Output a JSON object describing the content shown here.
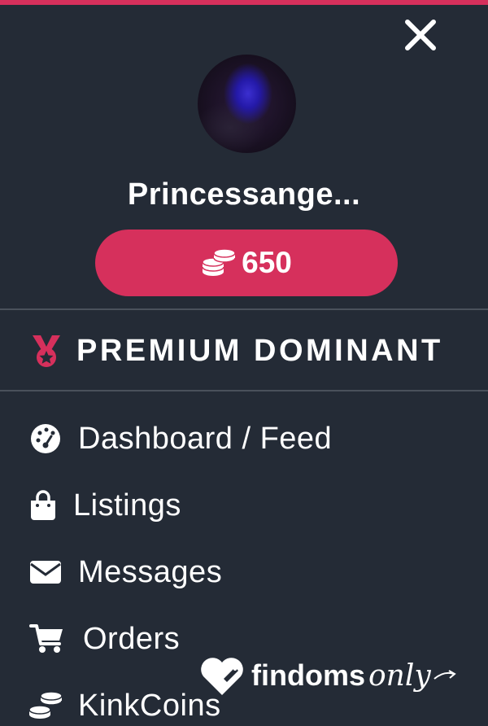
{
  "profile": {
    "username": "Princessange...",
    "balance": "650"
  },
  "membership": {
    "rank": "PREMIUM DOMINANT"
  },
  "menu": {
    "items": [
      {
        "label": "Dashboard / Feed",
        "icon": "dashboard-gauge-icon"
      },
      {
        "label": "Listings",
        "icon": "shopping-bag-icon"
      },
      {
        "label": "Messages",
        "icon": "envelope-icon"
      },
      {
        "label": "Orders",
        "icon": "shopping-cart-icon"
      },
      {
        "label": "KinkCoins",
        "icon": "coins-icon"
      }
    ]
  },
  "brand": {
    "name_bold": "findoms",
    "name_script": "only"
  },
  "colors": {
    "background": "#242b36",
    "accent": "#d6305c",
    "divider": "#4a515b",
    "text": "#ffffff"
  }
}
